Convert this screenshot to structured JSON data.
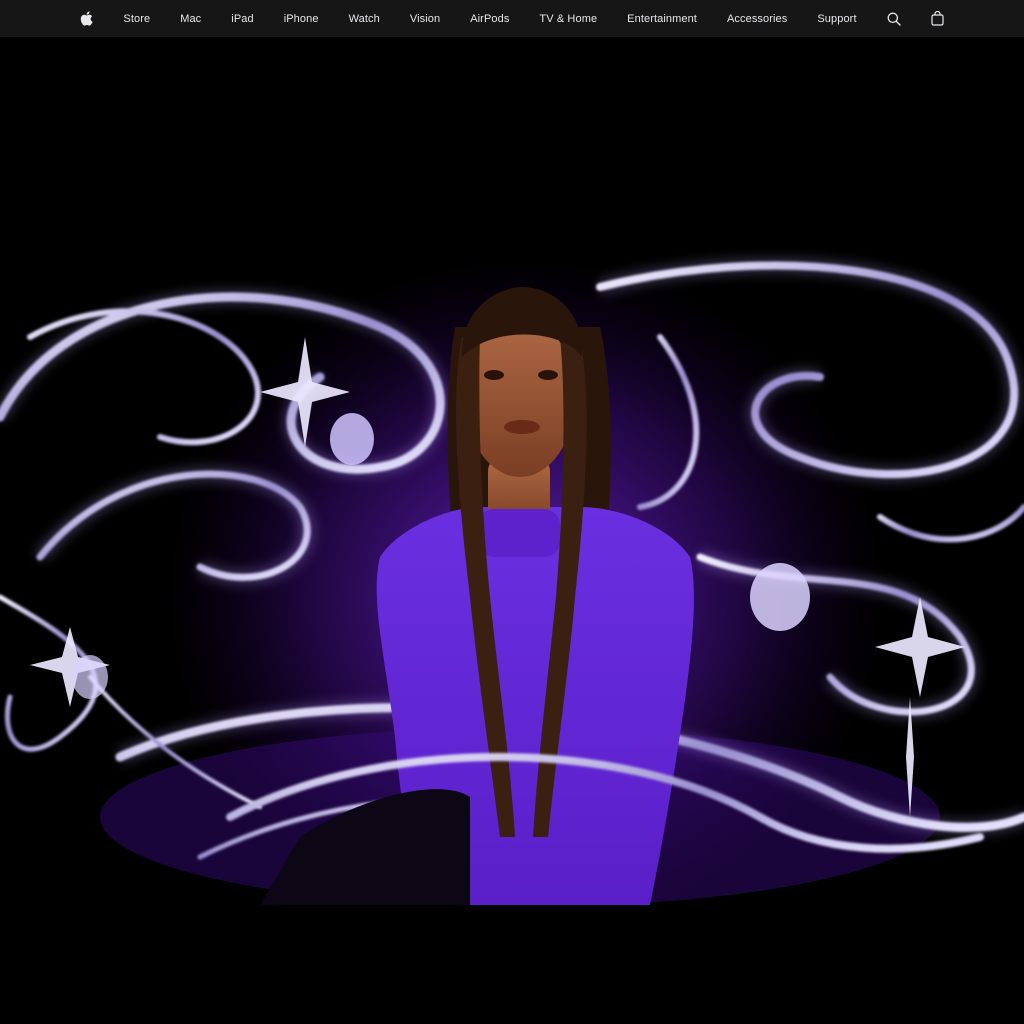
{
  "nav": {
    "apple_icon": "apple-logo-icon",
    "items": [
      {
        "label": "Store"
      },
      {
        "label": "Mac"
      },
      {
        "label": "iPad"
      },
      {
        "label": "iPhone"
      },
      {
        "label": "Watch"
      },
      {
        "label": "Vision"
      },
      {
        "label": "AirPods"
      },
      {
        "label": "TV & Home"
      },
      {
        "label": "Entertainment"
      },
      {
        "label": "Accessories"
      },
      {
        "label": "Support"
      }
    ],
    "search_icon": "search-icon",
    "bag_icon": "bag-icon"
  },
  "colors": {
    "nav_background": "#161617",
    "nav_text": "#e8e8ed",
    "page_background": "#000000",
    "accent_purple": "#7b2fe0",
    "chrome_highlight": "#e6e0ff"
  }
}
